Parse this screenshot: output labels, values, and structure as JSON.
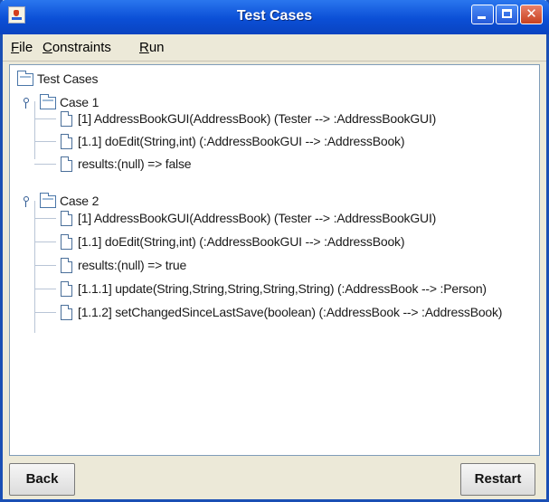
{
  "window": {
    "title": "Test Cases"
  },
  "menubar": {
    "file": {
      "first": "F",
      "rest": "ile"
    },
    "constraints": {
      "first": "C",
      "rest": "onstraints"
    },
    "run": {
      "first": "R",
      "rest": "un"
    }
  },
  "tree": {
    "root": "Test Cases",
    "cases": [
      {
        "label": "Case 1",
        "expanded": true,
        "items": [
          "[1] AddressBookGUI(AddressBook) (Tester --> :AddressBookGUI)",
          "[1.1] doEdit(String,int) (:AddressBookGUI --> :AddressBook)",
          "results:(null) => false"
        ]
      },
      {
        "label": "Case 2",
        "expanded": true,
        "items": [
          "[1] AddressBookGUI(AddressBook) (Tester --> :AddressBookGUI)",
          "[1.1] doEdit(String,int) (:AddressBookGUI --> :AddressBook)",
          "results:(null) => true",
          "[1.1.1] update(String,String,String,String,String) (:AddressBook --> :Person)",
          "[1.1.2] setChangedSinceLastSave(boolean) (:AddressBook --> :AddressBook)"
        ]
      }
    ]
  },
  "buttons": {
    "back": "Back",
    "restart": "Restart"
  }
}
